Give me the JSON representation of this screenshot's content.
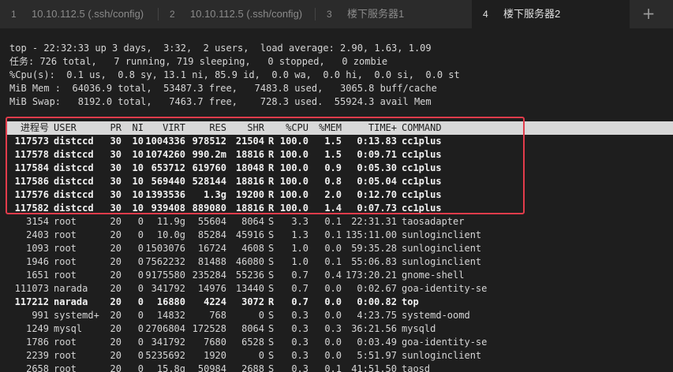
{
  "tabs": [
    {
      "num": "1",
      "label": "10.10.112.5 (.ssh/config)",
      "active": false
    },
    {
      "num": "2",
      "label": "10.10.112.5 (.ssh/config)",
      "active": false
    },
    {
      "num": "3",
      "label": "楼下服务器1",
      "active": false
    },
    {
      "num": "4",
      "label": "楼下服务器2",
      "active": true
    }
  ],
  "new_tab_label": "+",
  "summary": [
    "top - 22:32:33 up 3 days,  3:32,  2 users,  load average: 2.90, 1.63, 1.09",
    "任务: 726 total,   7 running, 719 sleeping,   0 stopped,   0 zombie",
    "%Cpu(s):  0.1 us,  0.8 sy, 13.1 ni, 85.9 id,  0.0 wa,  0.0 hi,  0.0 si,  0.0 st",
    "MiB Mem :  64036.9 total,  53487.3 free,   7483.8 used,   3065.8 buff/cache",
    "MiB Swap:   8192.0 total,   7463.7 free,    728.3 used.  55924.3 avail Mem"
  ],
  "columns": [
    "进程号",
    "USER",
    "PR",
    "NI",
    "VIRT",
    "RES",
    "SHR",
    "",
    "%CPU",
    "%MEM",
    "TIME+",
    "COMMAND"
  ],
  "processes": [
    [
      "117573",
      "distccd",
      "30",
      "10",
      "1004336",
      "978512",
      "21504",
      "R",
      "100.0",
      "1.5",
      "0:13.83",
      "cc1plus"
    ],
    [
      "117578",
      "distccd",
      "30",
      "10",
      "1074260",
      "990.2m",
      "18816",
      "R",
      "100.0",
      "1.5",
      "0:09.71",
      "cc1plus"
    ],
    [
      "117584",
      "distccd",
      "30",
      "10",
      "653712",
      "619760",
      "18048",
      "R",
      "100.0",
      "0.9",
      "0:05.30",
      "cc1plus"
    ],
    [
      "117586",
      "distccd",
      "30",
      "10",
      "569440",
      "528144",
      "18816",
      "R",
      "100.0",
      "0.8",
      "0:05.04",
      "cc1plus"
    ],
    [
      "117576",
      "distccd",
      "30",
      "10",
      "1393536",
      "1.3g",
      "19200",
      "R",
      "100.0",
      "2.0",
      "0:12.70",
      "cc1plus"
    ],
    [
      "117582",
      "distccd",
      "30",
      "10",
      "939408",
      "889080",
      "18816",
      "R",
      "100.0",
      "1.4",
      "0:07.73",
      "cc1plus"
    ],
    [
      "3154",
      "root",
      "20",
      "0",
      "11.9g",
      "55604",
      "8064",
      "S",
      "3.3",
      "0.1",
      "22:31.31",
      "taosadapter"
    ],
    [
      "2403",
      "root",
      "20",
      "0",
      "10.0g",
      "85284",
      "45916",
      "S",
      "1.3",
      "0.1",
      "135:11.00",
      "sunloginclient"
    ],
    [
      "1093",
      "root",
      "20",
      "0",
      "1503076",
      "16724",
      "4608",
      "S",
      "1.0",
      "0.0",
      "59:35.28",
      "sunloginclient"
    ],
    [
      "1946",
      "root",
      "20",
      "0",
      "7562232",
      "81488",
      "46080",
      "S",
      "1.0",
      "0.1",
      "55:06.83",
      "sunloginclient"
    ],
    [
      "1651",
      "root",
      "20",
      "0",
      "9175580",
      "235284",
      "55236",
      "S",
      "0.7",
      "0.4",
      "173:20.21",
      "gnome-shell"
    ],
    [
      "111073",
      "narada",
      "20",
      "0",
      "341792",
      "14976",
      "13440",
      "S",
      "0.7",
      "0.0",
      "0:02.67",
      "goa-identity-se"
    ],
    [
      "117212",
      "narada",
      "20",
      "0",
      "16880",
      "4224",
      "3072",
      "R",
      "0.7",
      "0.0",
      "0:00.82",
      "top"
    ],
    [
      "991",
      "systemd+",
      "20",
      "0",
      "14832",
      "768",
      "0",
      "S",
      "0.3",
      "0.0",
      "4:23.75",
      "systemd-oomd"
    ],
    [
      "1249",
      "mysql",
      "20",
      "0",
      "2706804",
      "172528",
      "8064",
      "S",
      "0.3",
      "0.3",
      "36:21.56",
      "mysqld"
    ],
    [
      "1786",
      "root",
      "20",
      "0",
      "341792",
      "7680",
      "6528",
      "S",
      "0.3",
      "0.0",
      "0:03.49",
      "goa-identity-se"
    ],
    [
      "2239",
      "root",
      "20",
      "0",
      "5235692",
      "1920",
      "0",
      "S",
      "0.3",
      "0.0",
      "5:51.97",
      "sunloginclient"
    ],
    [
      "2658",
      "root",
      "20",
      "0",
      "15.8g",
      "50984",
      "2688",
      "S",
      "0.3",
      "0.1",
      "41:51.50",
      "taosd"
    ]
  ],
  "bold_rows": [
    0,
    1,
    2,
    3,
    4,
    5,
    12
  ],
  "colors": {
    "background": "#1e1e1e",
    "text": "#d6d6d6",
    "header_bar": "#d8d8d8",
    "highlight_border": "#e23c4b"
  }
}
